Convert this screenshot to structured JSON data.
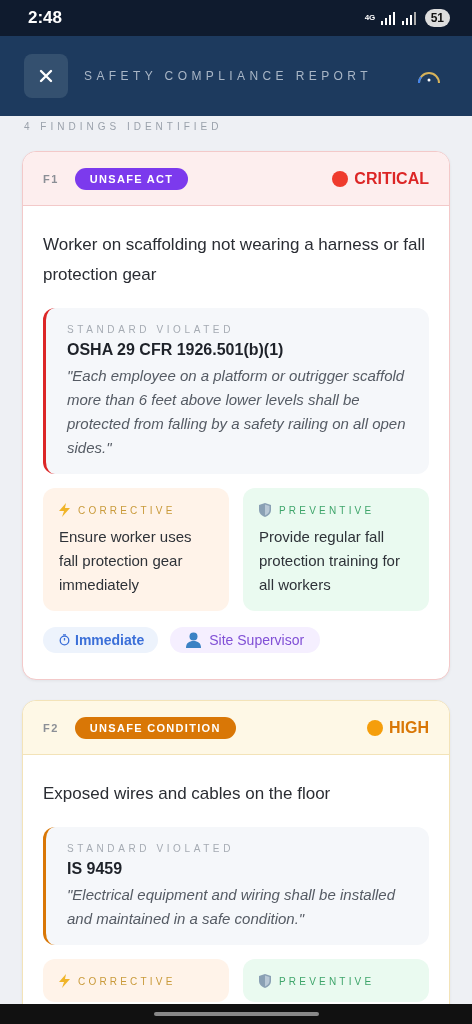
{
  "status_bar": {
    "time": "2:48",
    "network": "4G",
    "battery": "51"
  },
  "header": {
    "title": "SAFETY COMPLIANCE REPORT"
  },
  "summary": "4 FINDINGS IDENTIFIED",
  "findings": [
    {
      "id": "F1",
      "category": {
        "label": "UNSAFE ACT",
        "color": "#7c3aed"
      },
      "severity": {
        "label": "CRITICAL",
        "kind": "critical"
      },
      "description": "Worker on scaffolding not wearing a harness or fall protection gear",
      "standard": {
        "label": "STANDARD VIOLATED",
        "code": "OSHA 29 CFR 1926.501(b)(1)",
        "quote": "\"Each employee on a platform or outrigger scaffold more than 6 feet above lower levels shall be protected from falling by a safety railing on all open sides.\""
      },
      "actions": [
        {
          "kind": "corrective",
          "label": "CORRECTIVE",
          "text": "Ensure worker uses fall protection gear immediately"
        },
        {
          "kind": "preventive",
          "label": "PREVENTIVE",
          "text": "Provide regular fall protection training for all workers"
        }
      ],
      "tags": [
        {
          "kind": "time",
          "label": "Immediate"
        },
        {
          "kind": "person",
          "label": "Site Supervisor"
        }
      ]
    },
    {
      "id": "F2",
      "category": {
        "label": "UNSAFE CONDITION",
        "color": "#d97706"
      },
      "severity": {
        "label": "HIGH",
        "kind": "high"
      },
      "description": "Exposed wires and cables on the floor",
      "standard": {
        "label": "STANDARD VIOLATED",
        "code": "IS 9459",
        "quote": "\"Electrical equipment and wiring shall be installed and maintained in a safe condition.\""
      },
      "actions": [
        {
          "kind": "corrective",
          "label": "CORRECTIVE"
        },
        {
          "kind": "preventive",
          "label": "PREVENTIVE"
        }
      ]
    }
  ]
}
